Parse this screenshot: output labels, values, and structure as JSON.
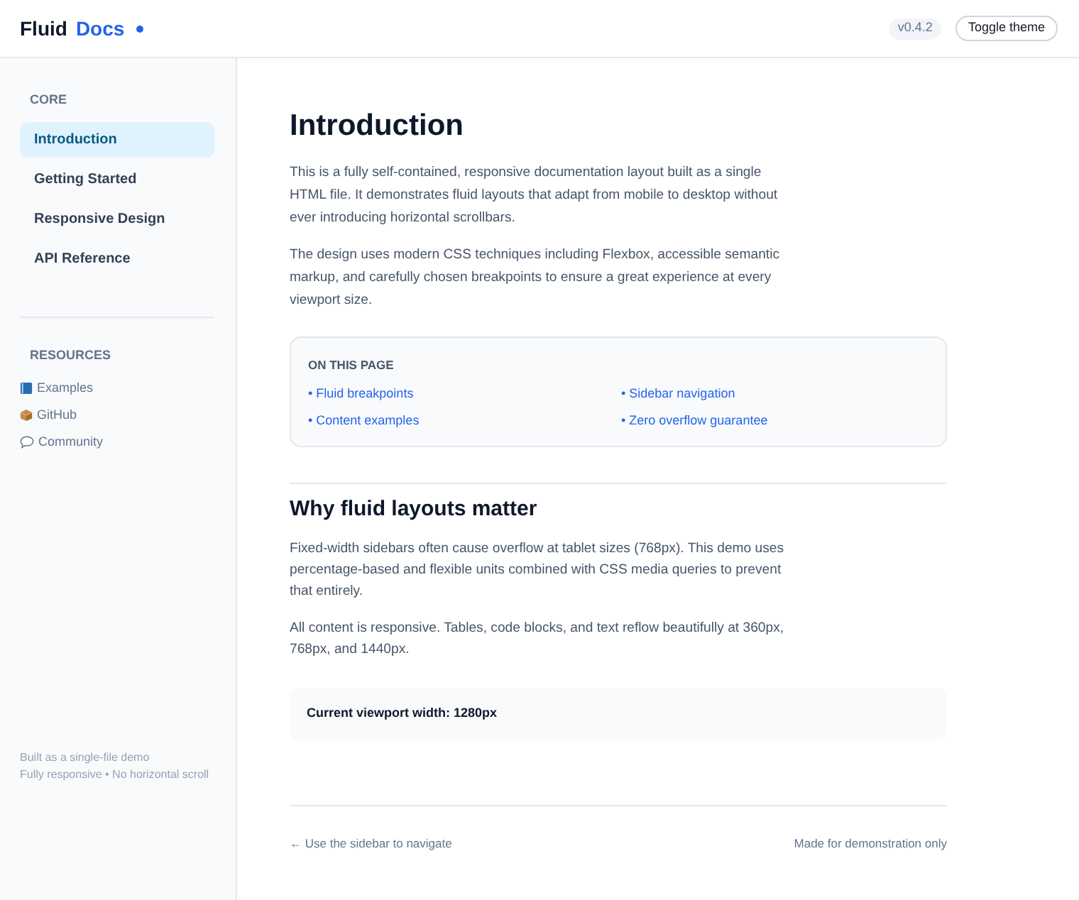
{
  "header": {
    "brand": "Fluid",
    "brand_accent": "Docs",
    "version": "v0.4.2",
    "toggle_button": "Toggle theme"
  },
  "sidebar": {
    "sections": [
      {
        "title": "CORE",
        "kind": "nav",
        "items": [
          {
            "label": "Introduction",
            "selected": true
          },
          {
            "label": "Getting Started",
            "selected": false
          },
          {
            "label": "Responsive Design",
            "selected": false
          },
          {
            "label": "API Reference",
            "selected": false
          }
        ]
      },
      {
        "title": "RESOURCES",
        "kind": "links",
        "items": [
          {
            "label": "Examples"
          },
          {
            "label": "GitHub"
          },
          {
            "label": "Community"
          }
        ]
      }
    ],
    "footer": [
      "Built as a single-file demo",
      "Fully responsive • No horizontal scroll"
    ]
  },
  "main": {
    "title": "Introduction",
    "paragraphs": [
      "This is a fully self-contained, responsive documentation layout built as a single HTML file. It demonstrates fluid layouts that adapt from mobile to desktop without ever introducing horizontal scrollbars.",
      "The design uses modern CSS techniques including Flexbox, accessible semantic markup, and carefully chosen breakpoints to ensure a great experience at every viewport size."
    ],
    "toc": {
      "title": "ON THIS PAGE",
      "links": [
        "• Fluid breakpoints",
        "• Sidebar navigation",
        "• Content examples",
        "• Zero overflow guarantee"
      ]
    },
    "section": {
      "title": "Why fluid layouts matter",
      "paragraphs": [
        "Fixed-width sidebars often cause overflow at tablet sizes (768px). This demo uses percentage-based and flexible units combined with CSS media queries to prevent that entirely.",
        "All content is responsive. Tables, code blocks, and text reflow beautifully at 360px, 768px, and 1440px."
      ]
    },
    "viewport_note": "Current viewport width: 1280px"
  },
  "footer": {
    "left": "← Use the sidebar to navigate",
    "right": "Made for demonstration only"
  }
}
